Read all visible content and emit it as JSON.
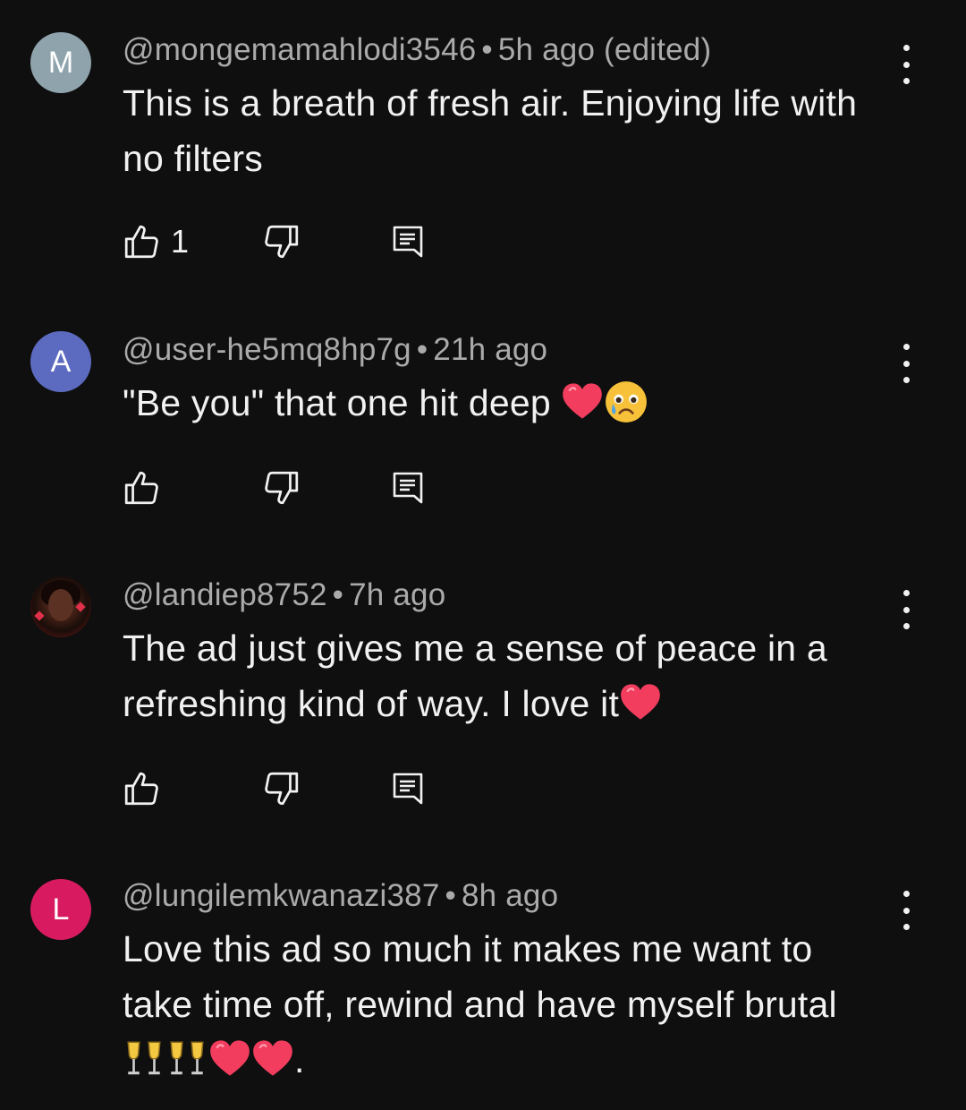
{
  "comments": [
    {
      "avatar_letter": "M",
      "avatar_color": "#8fa3ad",
      "handle": "@mongemamahlodi3546",
      "time": "5h ago (edited)",
      "lines": [
        "This is a breath of fresh air. Enjoying life with",
        "no filters"
      ],
      "like_count": "1"
    },
    {
      "avatar_letter": "A",
      "avatar_color": "#5c6bc0",
      "handle": "@user-he5mq8hp7g",
      "time": "21h ago",
      "lines": [
        "\"Be you\" that one hit deep"
      ],
      "emoji": [
        "red-heart",
        "crying-face"
      ]
    },
    {
      "avatar_letter": "",
      "handle": "@landiep8752",
      "time": "7h ago",
      "lines": [
        "The ad just gives me a sense of peace in a",
        "refreshing kind of way. I love it"
      ],
      "emoji": [
        "red-heart"
      ]
    },
    {
      "avatar_letter": "L",
      "avatar_color": "#d81b60",
      "handle": "@lungilemkwanazi387",
      "time": "8h ago",
      "lines": [
        "Love this ad so much it makes me want to",
        "take time off, rewind and have myself brutal",
        "."
      ],
      "emoji": [
        "clinking-glasses",
        "clinking-glasses",
        "red-heart",
        "red-heart"
      ]
    }
  ],
  "separator": "•",
  "icons": {
    "like": "thumbs-up-icon",
    "dislike": "thumbs-down-icon",
    "reply": "reply-comment-icon",
    "more": "more-vertical-icon"
  },
  "colors": {
    "background": "#0f0f0f",
    "text": "#f1f1f1",
    "meta": "#aaaaaa",
    "heart": "#f23d5e"
  }
}
